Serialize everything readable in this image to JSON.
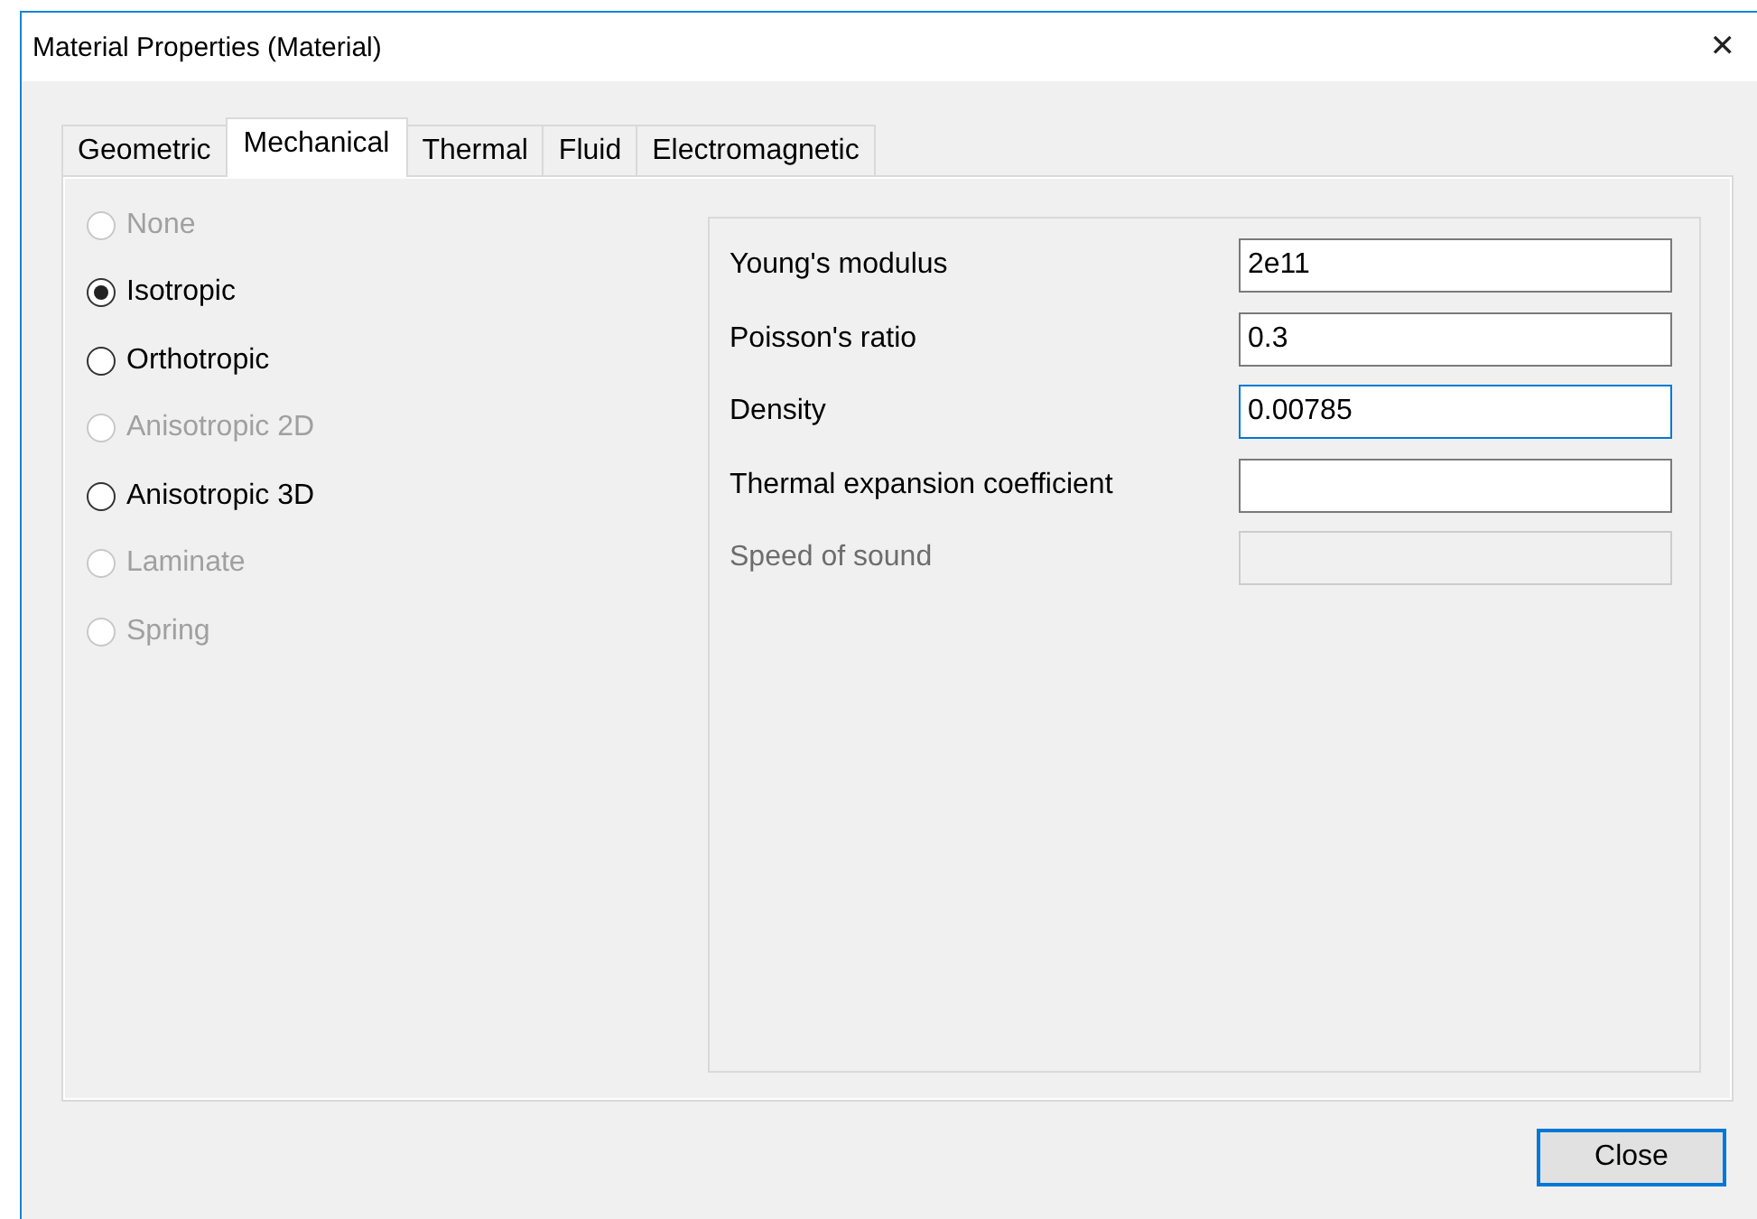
{
  "window": {
    "title": "Material Properties (Material)",
    "close_glyph": "✕"
  },
  "tabs": [
    {
      "label": "Geometric",
      "selected": false
    },
    {
      "label": "Mechanical",
      "selected": true
    },
    {
      "label": "Thermal",
      "selected": false
    },
    {
      "label": "Fluid",
      "selected": false
    },
    {
      "label": "Electromagnetic",
      "selected": false
    }
  ],
  "models": [
    {
      "label": "None",
      "selected": false,
      "disabled": true
    },
    {
      "label": "Isotropic",
      "selected": true,
      "disabled": false
    },
    {
      "label": "Orthotropic",
      "selected": false,
      "disabled": false
    },
    {
      "label": "Anisotropic 2D",
      "selected": false,
      "disabled": true
    },
    {
      "label": "Anisotropic 3D",
      "selected": false,
      "disabled": false
    },
    {
      "label": "Laminate",
      "selected": false,
      "disabled": true
    },
    {
      "label": "Spring",
      "selected": false,
      "disabled": true
    }
  ],
  "properties": [
    {
      "label": "Young's modulus",
      "value": "2e11",
      "focused": false,
      "disabled": false
    },
    {
      "label": "Poisson's ratio",
      "value": "0.3",
      "focused": false,
      "disabled": false
    },
    {
      "label": "Density",
      "value": "0.00785",
      "focused": true,
      "disabled": false
    },
    {
      "label": "Thermal expansion coefficient",
      "focused": false,
      "disabled": false
    },
    {
      "label": "Speed of sound",
      "focused": false,
      "disabled": true
    }
  ],
  "buttons": [
    {
      "label": "Close",
      "focused": true
    }
  ]
}
